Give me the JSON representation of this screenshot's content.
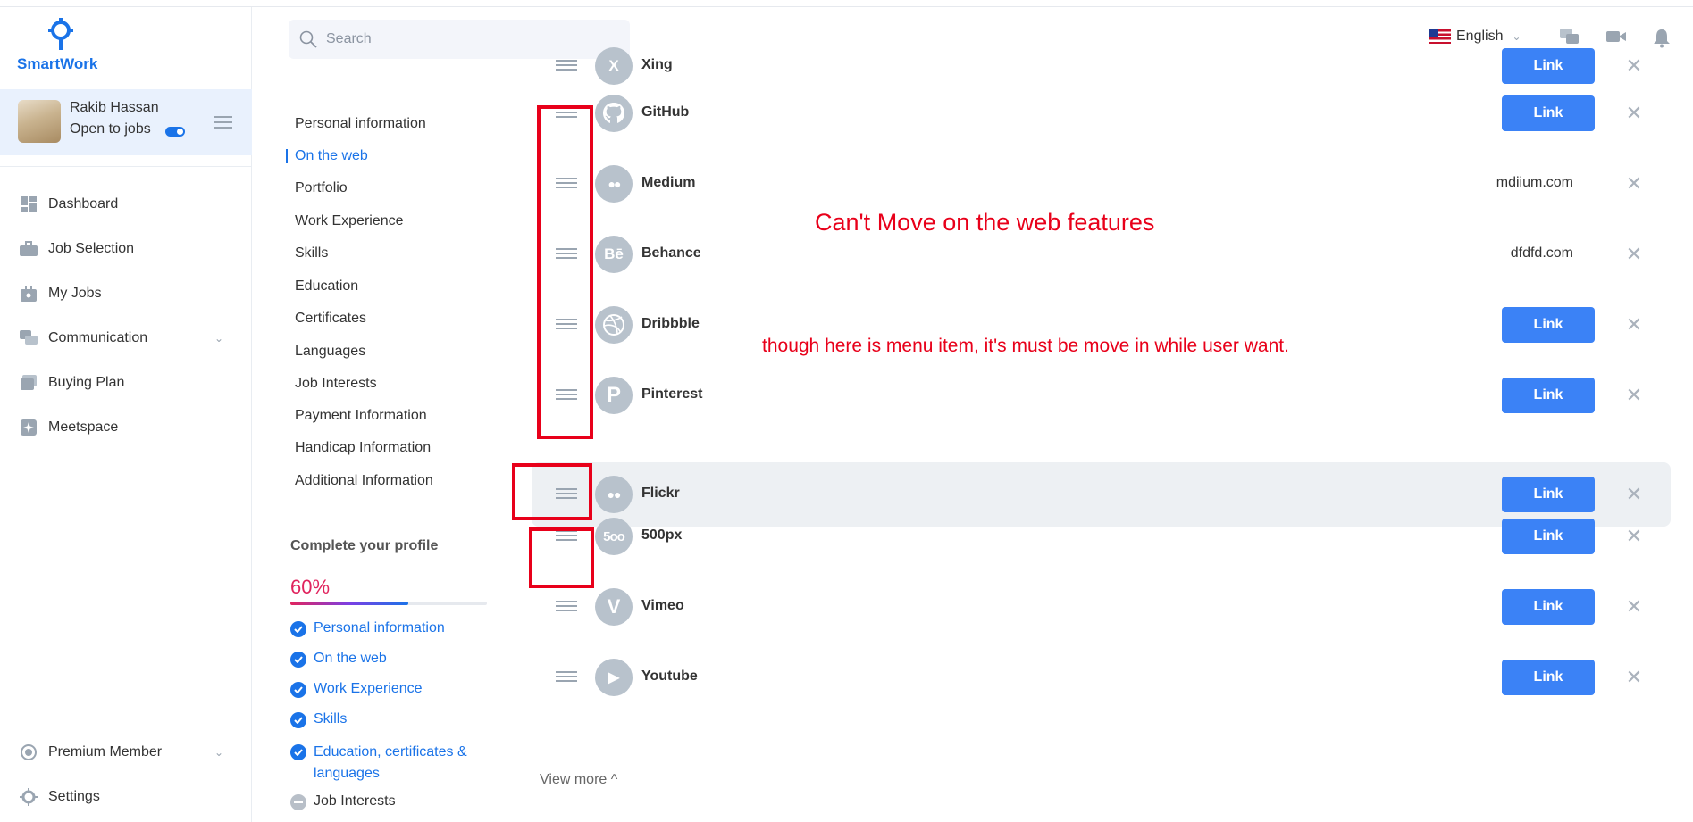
{
  "app": {
    "name": "SmartWork"
  },
  "user": {
    "name": "Rakib Hassan",
    "status": "Open to jobs"
  },
  "sidebar": {
    "items": [
      {
        "label": "Dashboard",
        "icon": "dashboard-icon"
      },
      {
        "label": "Job Selection",
        "icon": "briefcase-icon"
      },
      {
        "label": "My Jobs",
        "icon": "my-jobs-icon"
      },
      {
        "label": "Communication",
        "icon": "chat-icon"
      },
      {
        "label": "Buying Plan",
        "icon": "buying-plan-icon"
      },
      {
        "label": "Meetspace",
        "icon": "meetspace-icon"
      }
    ],
    "bottom": [
      {
        "label": "Premium Member",
        "icon": "premium-icon"
      },
      {
        "label": "Settings",
        "icon": "gear-icon"
      }
    ]
  },
  "header": {
    "search_placeholder": "Search",
    "language": "English"
  },
  "profile_menu": {
    "items": [
      "Personal information",
      "On the web",
      "Portfolio",
      "Work Experience",
      "Skills",
      "Education",
      "Certificates",
      "Languages",
      "Job Interests",
      "Payment Information",
      "Handicap Information",
      "Additional Information"
    ],
    "active": "On the web"
  },
  "profile_progress": {
    "title": "Complete your profile",
    "percent_label": "60%",
    "percent": 60,
    "items": [
      {
        "label": "Personal information",
        "done": true
      },
      {
        "label": "On the web",
        "done": true
      },
      {
        "label": "Work Experience",
        "done": true
      },
      {
        "label": "Skills",
        "done": true
      },
      {
        "label": "Education, certificates & languages",
        "done": true
      },
      {
        "label": "Job Interests",
        "done": false
      }
    ]
  },
  "web_links": [
    {
      "name": "Xing",
      "icon": "xing-icon",
      "glyph": "X",
      "action": "Link",
      "url": ""
    },
    {
      "name": "GitHub",
      "icon": "github-icon",
      "glyph": "",
      "action": "Link",
      "url": ""
    },
    {
      "name": "Medium",
      "icon": "medium-icon",
      "glyph": "●●",
      "action": "",
      "url": "mdiium.com"
    },
    {
      "name": "Behance",
      "icon": "behance-icon",
      "glyph": "Bē",
      "action": "",
      "url": "dfdfd.com"
    },
    {
      "name": "Dribbble",
      "icon": "dribbble-icon",
      "glyph": "◍",
      "action": "Link",
      "url": ""
    },
    {
      "name": "Pinterest",
      "icon": "pinterest-icon",
      "glyph": "P",
      "action": "Link",
      "url": ""
    },
    {
      "name": "Flickr",
      "icon": "flickr-icon",
      "glyph": "●●",
      "action": "Link",
      "url": ""
    },
    {
      "name": "500px",
      "icon": "500px-icon",
      "glyph": "5oo",
      "action": "Link",
      "url": ""
    },
    {
      "name": "Vimeo",
      "icon": "vimeo-icon",
      "glyph": "V",
      "action": "Link",
      "url": ""
    },
    {
      "name": "Youtube",
      "icon": "youtube-icon",
      "glyph": "▶",
      "action": "Link",
      "url": ""
    }
  ],
  "view_more": "View more ^",
  "annotations": {
    "note1": "Can't Move on the web features",
    "note2": "though here is menu item, it's must be move in while user want.",
    "color": "#e8001a"
  }
}
